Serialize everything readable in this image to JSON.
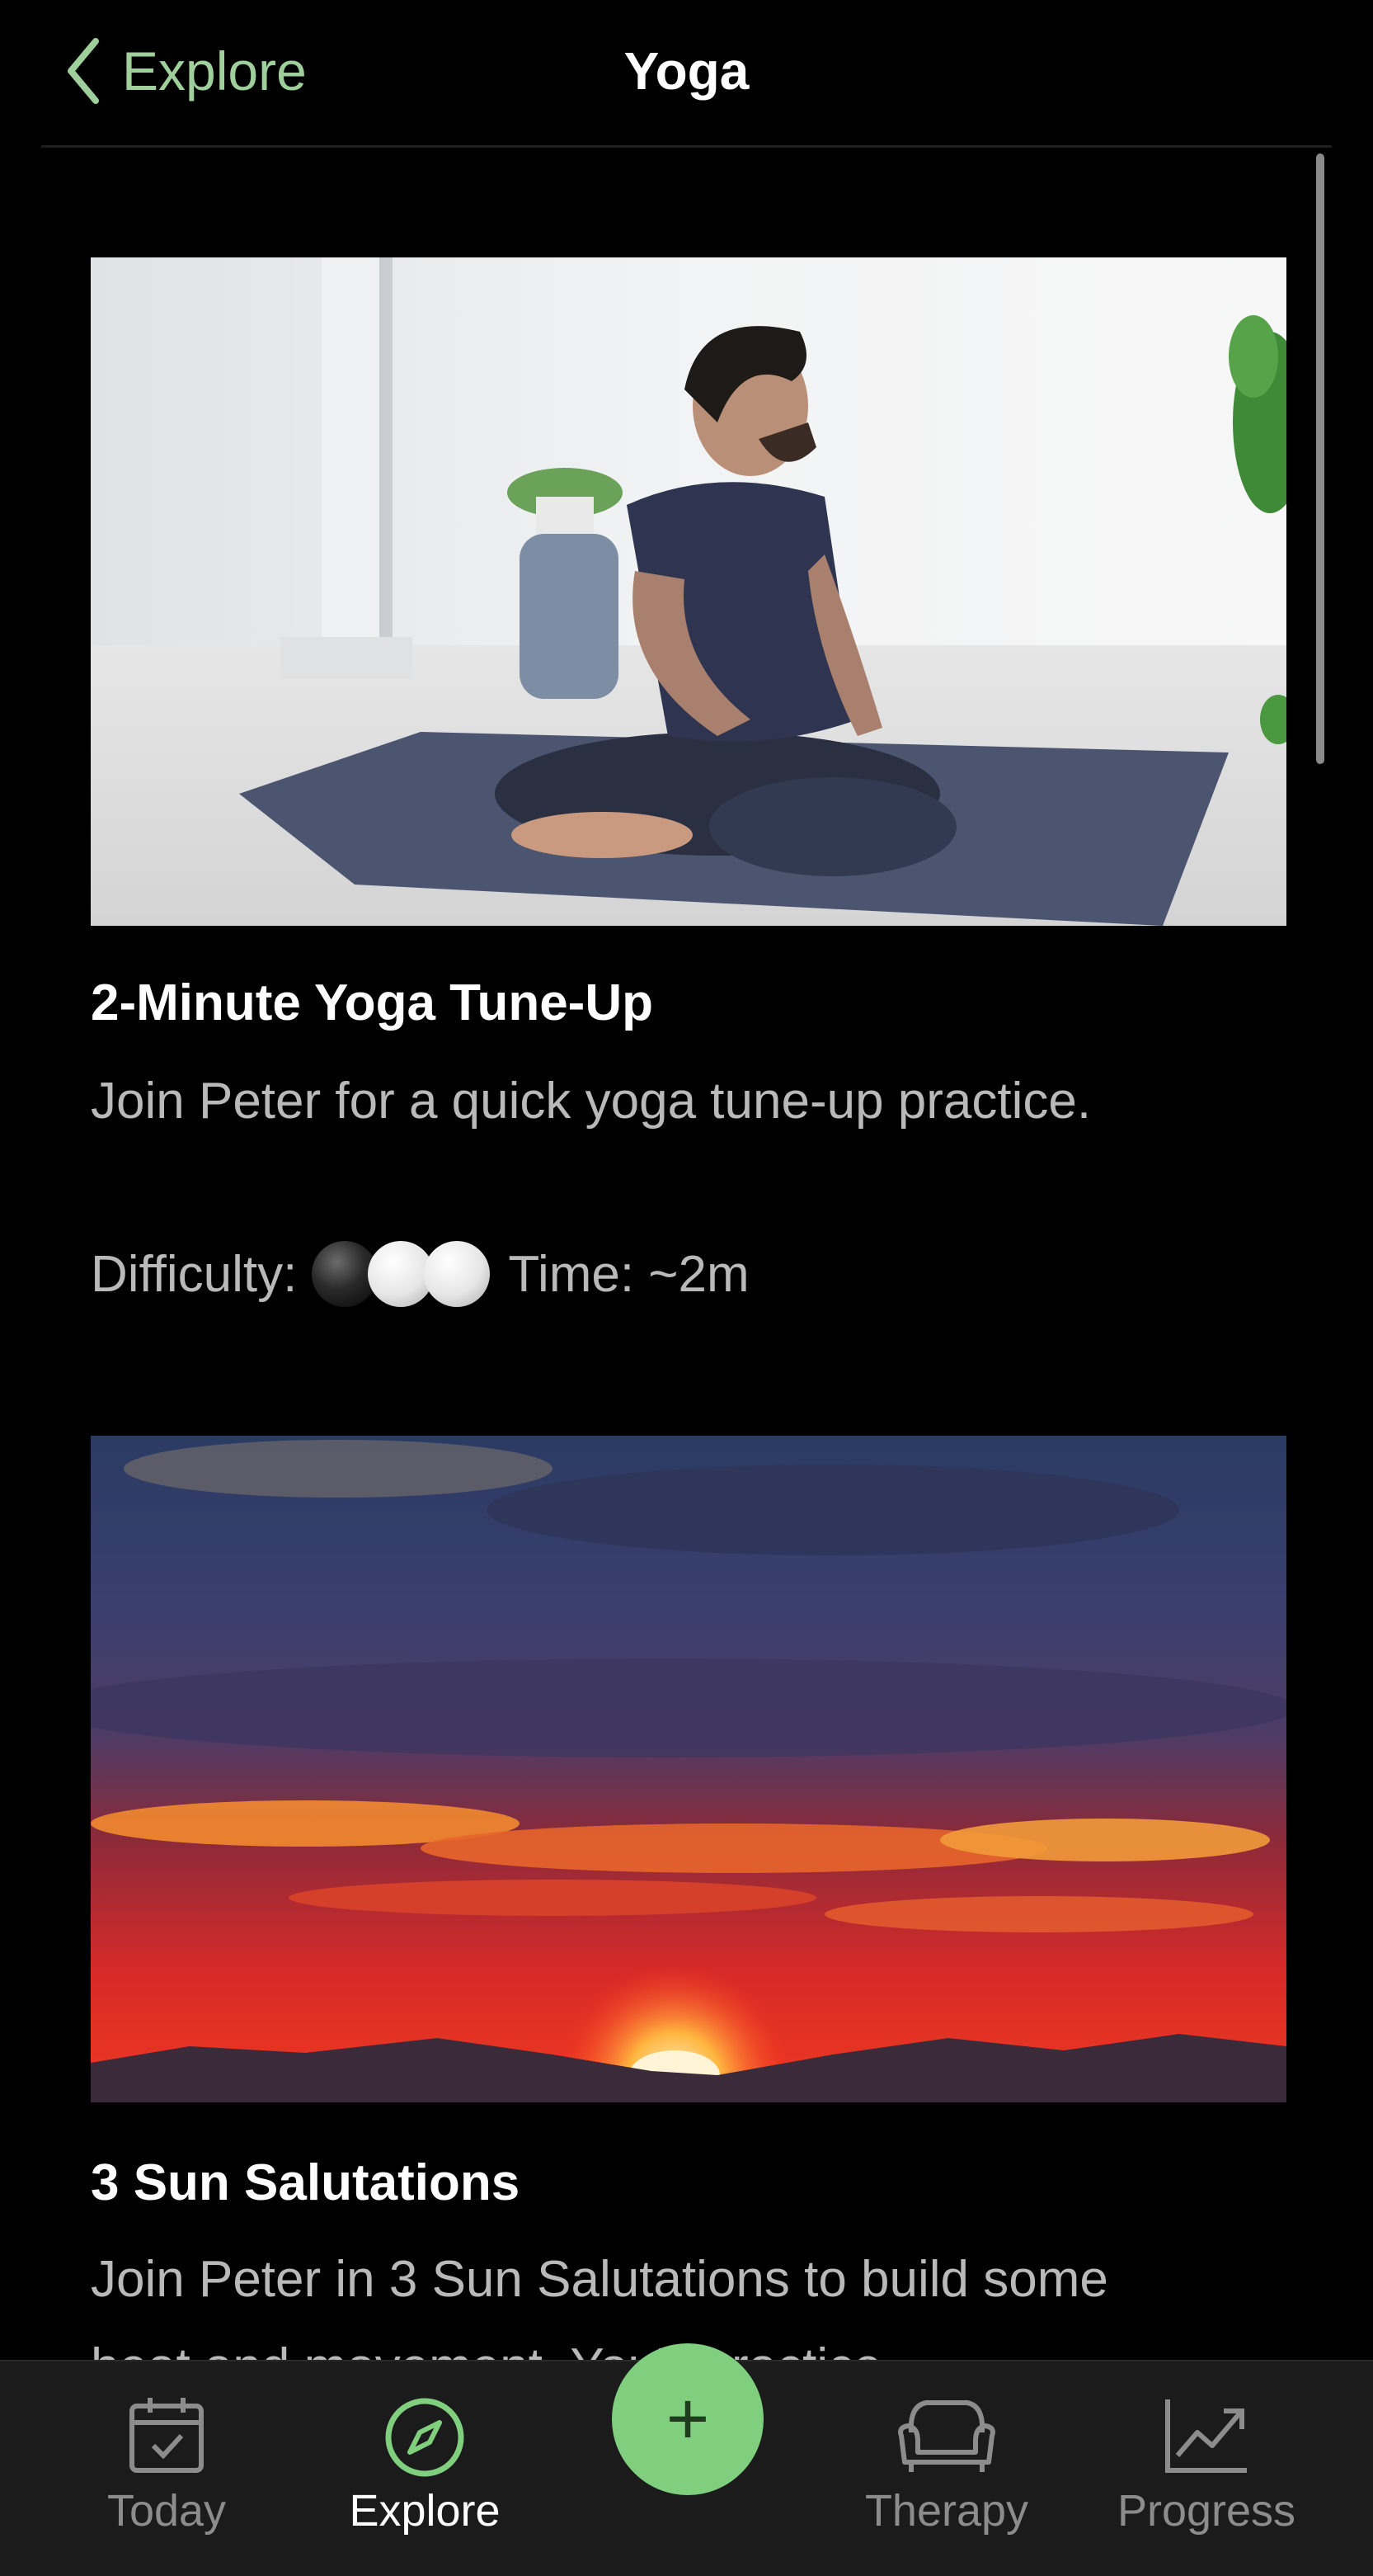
{
  "header": {
    "back_label": "Explore",
    "title": "Yoga"
  },
  "cards": [
    {
      "title": "2-Minute Yoga Tune-Up",
      "description": "Join Peter for a quick yoga tune-up practice.",
      "difficulty_label": "Difficulty:",
      "difficulty_level": 1,
      "difficulty_max": 3,
      "time_label": "Time: ~2m"
    },
    {
      "title": "3 Sun Salutations",
      "description": "Join Peter in 3 Sun Salutations to build some heat and movement. You'll practice"
    }
  ],
  "tabbar": {
    "tabs": [
      {
        "label": "Today",
        "icon": "calendar-icon"
      },
      {
        "label": "Explore",
        "icon": "compass-icon",
        "active": true
      },
      {
        "label": "Therapy",
        "icon": "couch-icon"
      },
      {
        "label": "Progress",
        "icon": "chart-icon"
      }
    ],
    "add_label": "+"
  },
  "colors": {
    "accent": "#9fcf9a",
    "add_button": "#7fcf7f",
    "background": "#000000",
    "tabbar_background": "#1b1b1b"
  }
}
